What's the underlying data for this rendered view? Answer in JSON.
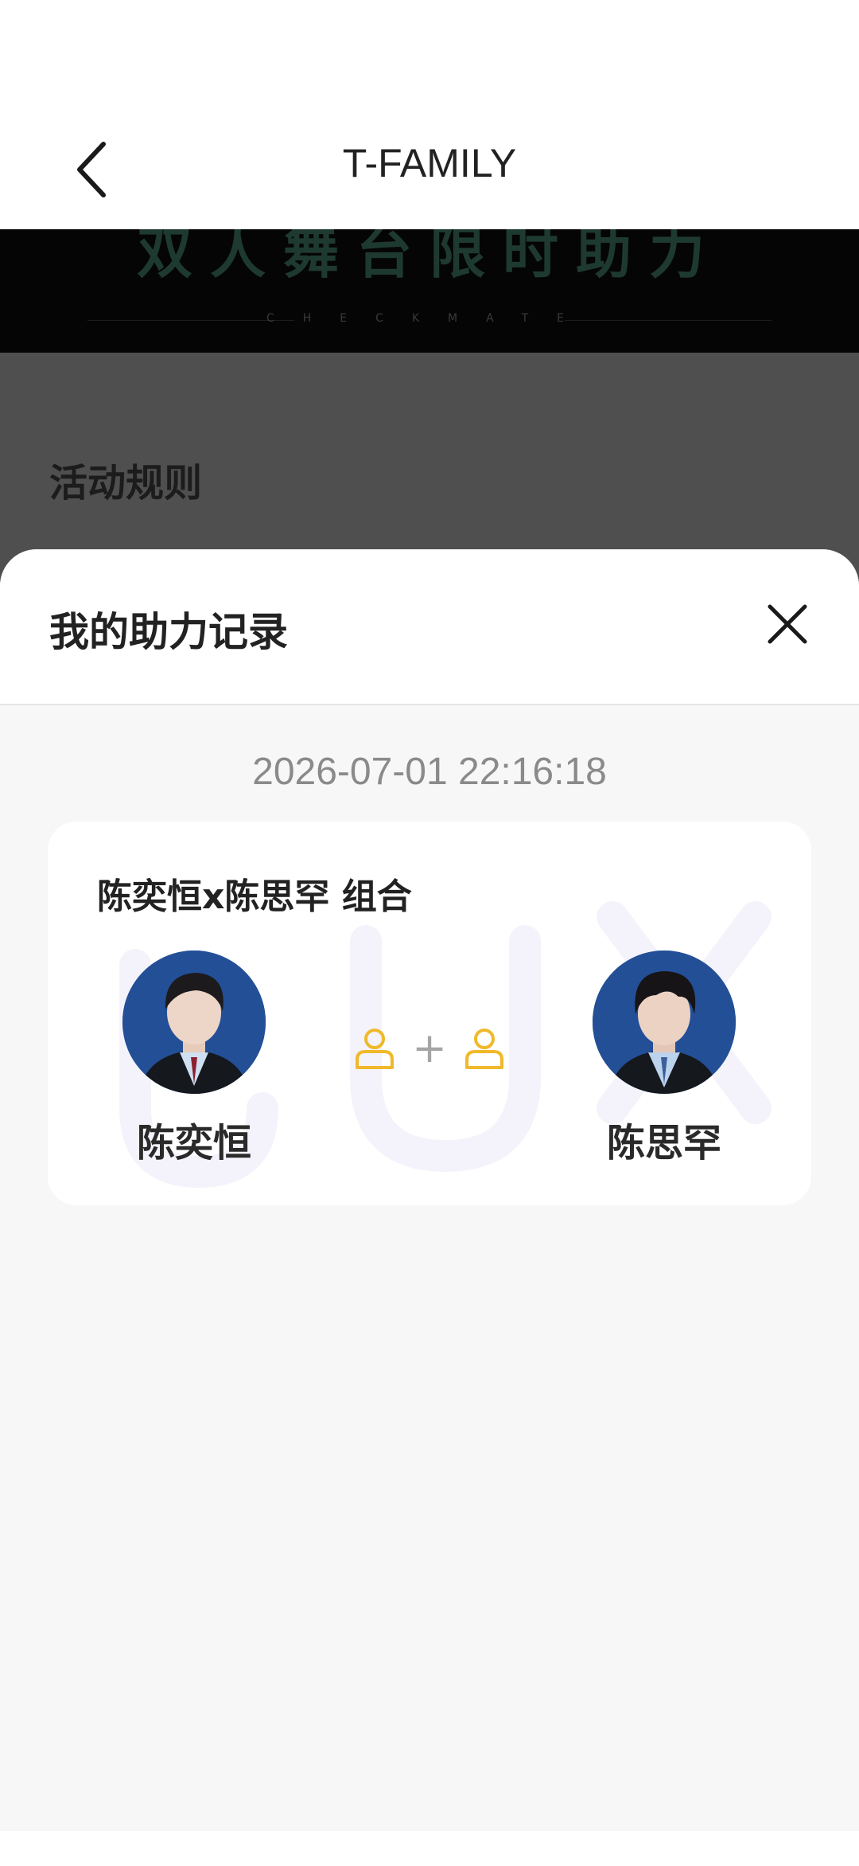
{
  "nav": {
    "title": "T-FAMILY",
    "back_icon": "chevron-left-icon"
  },
  "background": {
    "banner_title": "双人舞台限时助力",
    "banner_subtitle": "CHECKMATE",
    "rules_title": "活动规则"
  },
  "sheet": {
    "title": "我的助力记录",
    "close_icon": "close-icon",
    "records": [
      {
        "time": "2026-07-01 22:16:18",
        "combo_title": "陈奕恒x陈思罕 组合",
        "members": [
          {
            "name": "陈奕恒"
          },
          {
            "name": "陈思罕"
          }
        ],
        "combo_symbol": "+"
      }
    ]
  },
  "colors": {
    "accent_icon": "#f0b92b",
    "overlay": "#4f4f4f",
    "sheet_bg": "#f7f7f7",
    "avatar_bg": "#1f4b8f"
  }
}
